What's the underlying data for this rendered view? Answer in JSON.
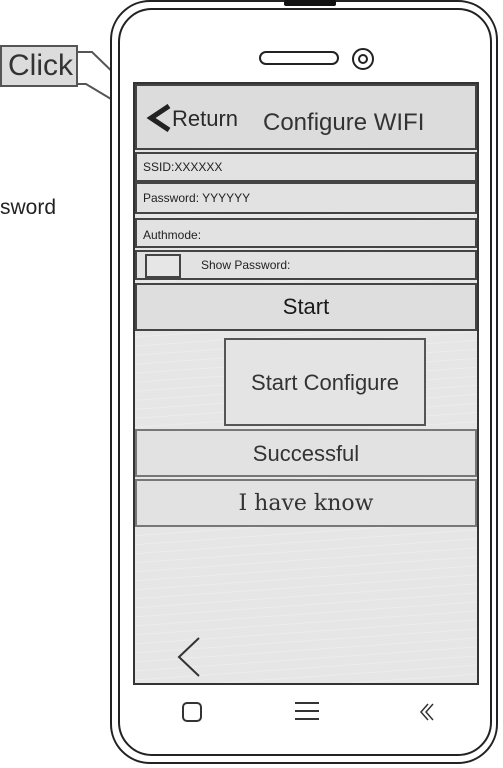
{
  "callout": {
    "label": "Click"
  },
  "side_text": "sword",
  "title_bar": {
    "return_label": "Return",
    "title": "Configure WIFI"
  },
  "fields": {
    "ssid": "SSID:XXXXXX",
    "password": "Password: YYYYYY",
    "authmode": "Authmode:",
    "show_password": "Show Password:"
  },
  "buttons": {
    "start": "Start",
    "start_configure": "Start Configure",
    "ack": "I have know"
  },
  "status_text": "Successful",
  "icons": {
    "return": "chevron-left-icon",
    "back": "back-triangle-icon",
    "nav_square": "square-icon",
    "nav_menu": "menu-icon",
    "nav_back": "chevron-left-small-icon"
  }
}
